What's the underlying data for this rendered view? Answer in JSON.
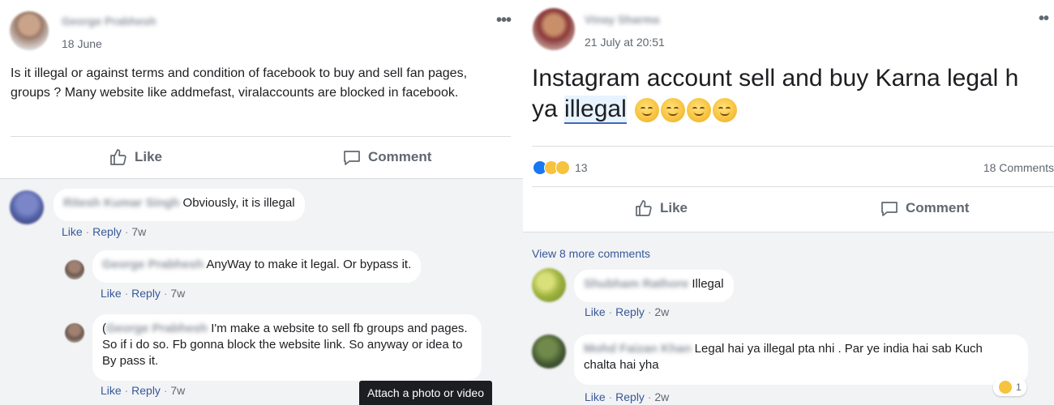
{
  "left_post": {
    "author": "George Prabhesh",
    "date": "18 June",
    "menu": "•••",
    "text": "Is it illegal or against terms and condition of facebook to buy and sell fan pages, groups ? Many website like addmefast, viralaccounts are blocked in facebook.",
    "like_label": "Like",
    "comment_label": "Comment",
    "comments": [
      {
        "author": "Ritesh Kumar Singh",
        "text": "Obviously, it is illegal",
        "like": "Like",
        "reply": "Reply",
        "age": "7w"
      },
      {
        "author": "George Prabhesh",
        "text": "AnyWay to make it legal. Or bypass it.",
        "like": "Like",
        "reply": "Reply",
        "age": "7w"
      },
      {
        "author": "George Prabhesh",
        "prefix": "(",
        "text": "I'm make a website to sell fb groups and pages. So if i do so. Fb gonna block the website link. So anyway or idea to By pass it.",
        "like": "Like",
        "reply": "Reply",
        "age": "7w"
      }
    ],
    "tooltip": "Attach a photo or video"
  },
  "right_post": {
    "author": "Vinay Sharma",
    "date": "21 July at 20:51",
    "menu": "••",
    "text_before": "Instagram account sell and buy Karna legal h ya ",
    "text_highlight": "illegal",
    "emoji_name": "grinning-squinting-face-emoji",
    "reaction_count": "13",
    "comment_count": "18 Comments",
    "like_label": "Like",
    "comment_label": "Comment",
    "view_more": "View 8 more comments",
    "comments": [
      {
        "author": "Shubham Rathore",
        "text": "Illegal",
        "like": "Like",
        "reply": "Reply",
        "age": "2w"
      },
      {
        "author": "Mohd Faizan Khan",
        "text": "Legal hai ya illegal pta nhi . Par ye india hai sab Kuch chalta hai yha",
        "like": "Like",
        "reply": "Reply",
        "age": "2w",
        "reaction_count": "1"
      }
    ]
  },
  "colors": {
    "link": "#385898",
    "muted": "#606770",
    "comment_bg": "#f2f3f5",
    "like_blue": "#1877f2"
  }
}
